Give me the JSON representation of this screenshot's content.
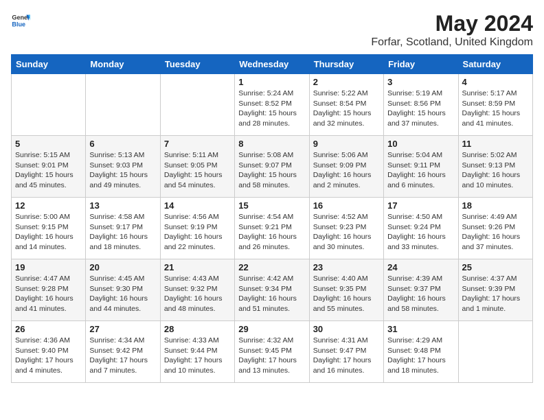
{
  "header": {
    "logo_general": "General",
    "logo_blue": "Blue",
    "month_title": "May 2024",
    "location": "Forfar, Scotland, United Kingdom"
  },
  "days_of_week": [
    "Sunday",
    "Monday",
    "Tuesday",
    "Wednesday",
    "Thursday",
    "Friday",
    "Saturday"
  ],
  "weeks": [
    [
      {
        "day": "",
        "info": ""
      },
      {
        "day": "",
        "info": ""
      },
      {
        "day": "",
        "info": ""
      },
      {
        "day": "1",
        "info": "Sunrise: 5:24 AM\nSunset: 8:52 PM\nDaylight: 15 hours\nand 28 minutes."
      },
      {
        "day": "2",
        "info": "Sunrise: 5:22 AM\nSunset: 8:54 PM\nDaylight: 15 hours\nand 32 minutes."
      },
      {
        "day": "3",
        "info": "Sunrise: 5:19 AM\nSunset: 8:56 PM\nDaylight: 15 hours\nand 37 minutes."
      },
      {
        "day": "4",
        "info": "Sunrise: 5:17 AM\nSunset: 8:59 PM\nDaylight: 15 hours\nand 41 minutes."
      }
    ],
    [
      {
        "day": "5",
        "info": "Sunrise: 5:15 AM\nSunset: 9:01 PM\nDaylight: 15 hours\nand 45 minutes."
      },
      {
        "day": "6",
        "info": "Sunrise: 5:13 AM\nSunset: 9:03 PM\nDaylight: 15 hours\nand 49 minutes."
      },
      {
        "day": "7",
        "info": "Sunrise: 5:11 AM\nSunset: 9:05 PM\nDaylight: 15 hours\nand 54 minutes."
      },
      {
        "day": "8",
        "info": "Sunrise: 5:08 AM\nSunset: 9:07 PM\nDaylight: 15 hours\nand 58 minutes."
      },
      {
        "day": "9",
        "info": "Sunrise: 5:06 AM\nSunset: 9:09 PM\nDaylight: 16 hours\nand 2 minutes."
      },
      {
        "day": "10",
        "info": "Sunrise: 5:04 AM\nSunset: 9:11 PM\nDaylight: 16 hours\nand 6 minutes."
      },
      {
        "day": "11",
        "info": "Sunrise: 5:02 AM\nSunset: 9:13 PM\nDaylight: 16 hours\nand 10 minutes."
      }
    ],
    [
      {
        "day": "12",
        "info": "Sunrise: 5:00 AM\nSunset: 9:15 PM\nDaylight: 16 hours\nand 14 minutes."
      },
      {
        "day": "13",
        "info": "Sunrise: 4:58 AM\nSunset: 9:17 PM\nDaylight: 16 hours\nand 18 minutes."
      },
      {
        "day": "14",
        "info": "Sunrise: 4:56 AM\nSunset: 9:19 PM\nDaylight: 16 hours\nand 22 minutes."
      },
      {
        "day": "15",
        "info": "Sunrise: 4:54 AM\nSunset: 9:21 PM\nDaylight: 16 hours\nand 26 minutes."
      },
      {
        "day": "16",
        "info": "Sunrise: 4:52 AM\nSunset: 9:23 PM\nDaylight: 16 hours\nand 30 minutes."
      },
      {
        "day": "17",
        "info": "Sunrise: 4:50 AM\nSunset: 9:24 PM\nDaylight: 16 hours\nand 33 minutes."
      },
      {
        "day": "18",
        "info": "Sunrise: 4:49 AM\nSunset: 9:26 PM\nDaylight: 16 hours\nand 37 minutes."
      }
    ],
    [
      {
        "day": "19",
        "info": "Sunrise: 4:47 AM\nSunset: 9:28 PM\nDaylight: 16 hours\nand 41 minutes."
      },
      {
        "day": "20",
        "info": "Sunrise: 4:45 AM\nSunset: 9:30 PM\nDaylight: 16 hours\nand 44 minutes."
      },
      {
        "day": "21",
        "info": "Sunrise: 4:43 AM\nSunset: 9:32 PM\nDaylight: 16 hours\nand 48 minutes."
      },
      {
        "day": "22",
        "info": "Sunrise: 4:42 AM\nSunset: 9:34 PM\nDaylight: 16 hours\nand 51 minutes."
      },
      {
        "day": "23",
        "info": "Sunrise: 4:40 AM\nSunset: 9:35 PM\nDaylight: 16 hours\nand 55 minutes."
      },
      {
        "day": "24",
        "info": "Sunrise: 4:39 AM\nSunset: 9:37 PM\nDaylight: 16 hours\nand 58 minutes."
      },
      {
        "day": "25",
        "info": "Sunrise: 4:37 AM\nSunset: 9:39 PM\nDaylight: 17 hours\nand 1 minute."
      }
    ],
    [
      {
        "day": "26",
        "info": "Sunrise: 4:36 AM\nSunset: 9:40 PM\nDaylight: 17 hours\nand 4 minutes."
      },
      {
        "day": "27",
        "info": "Sunrise: 4:34 AM\nSunset: 9:42 PM\nDaylight: 17 hours\nand 7 minutes."
      },
      {
        "day": "28",
        "info": "Sunrise: 4:33 AM\nSunset: 9:44 PM\nDaylight: 17 hours\nand 10 minutes."
      },
      {
        "day": "29",
        "info": "Sunrise: 4:32 AM\nSunset: 9:45 PM\nDaylight: 17 hours\nand 13 minutes."
      },
      {
        "day": "30",
        "info": "Sunrise: 4:31 AM\nSunset: 9:47 PM\nDaylight: 17 hours\nand 16 minutes."
      },
      {
        "day": "31",
        "info": "Sunrise: 4:29 AM\nSunset: 9:48 PM\nDaylight: 17 hours\nand 18 minutes."
      },
      {
        "day": "",
        "info": ""
      }
    ]
  ]
}
